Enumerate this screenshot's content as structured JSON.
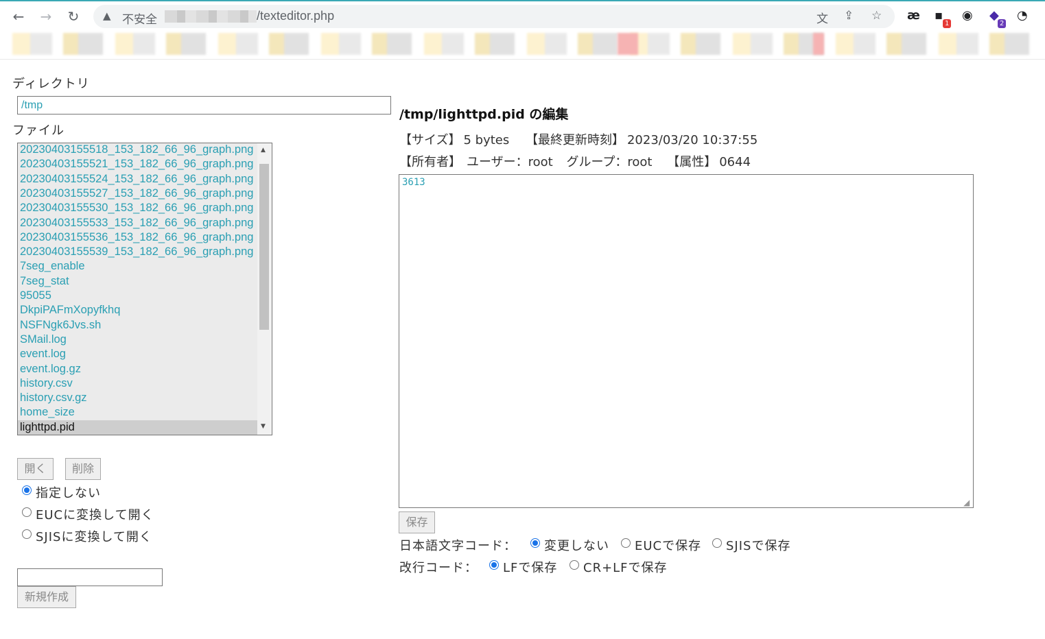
{
  "browser": {
    "insecure_label": "不安全",
    "url_path": "/texteditor.php",
    "extensions": [
      {
        "name": "ae-icon",
        "glyph": "æ"
      },
      {
        "name": "extension-badge-icon",
        "badge": "1",
        "badge_color": "#e53935"
      },
      {
        "name": "ring-icon",
        "glyph": "◉"
      },
      {
        "name": "stack-icon",
        "badge": "2",
        "badge_color": "#673ab7"
      }
    ]
  },
  "directory": {
    "label": "ディレクトリ",
    "value": "/tmp"
  },
  "file": {
    "label": "ファイル",
    "items": [
      "20230403155518_153_182_66_96_graph.png",
      "20230403155521_153_182_66_96_graph.png",
      "20230403155524_153_182_66_96_graph.png",
      "20230403155527_153_182_66_96_graph.png",
      "20230403155530_153_182_66_96_graph.png",
      "20230403155533_153_182_66_96_graph.png",
      "20230403155536_153_182_66_96_graph.png",
      "20230403155539_153_182_66_96_graph.png",
      "7seg_enable",
      "7seg_stat",
      "95055",
      "DkpiPAFmXopyfkhq",
      "NSFNgk6Jvs.sh",
      "SMail.log",
      "event.log",
      "event.log.gz",
      "history.csv",
      "history.csv.gz",
      "home_size",
      "lighttpd.pid"
    ],
    "selected": "lighttpd.pid"
  },
  "actions": {
    "open_label": "開く",
    "delete_label": "削除",
    "new_label": "新規作成",
    "new_value": ""
  },
  "open_options": [
    {
      "label": "指定しない",
      "checked": true
    },
    {
      "label": "EUCに変換して開く",
      "checked": false
    },
    {
      "label": "SJISに変換して開く",
      "checked": false
    }
  ],
  "editor": {
    "title": "/tmp/lighttpd.pid の編集",
    "size_label": "【サイズ】",
    "size_value": "5 bytes",
    "mtime_label": "【最終更新時刻】",
    "mtime_value": "2023/03/20 10:37:55",
    "owner_label": "【所有者】",
    "user_text": "ユーザー：root",
    "group_text": "グループ：root",
    "perm_label": "【属性】",
    "perm_value": "0644",
    "content": "3613",
    "save_label": "保存"
  },
  "encoding": {
    "label": "日本語文字コード：",
    "options": [
      {
        "label": "変更しない",
        "checked": true
      },
      {
        "label": "EUCで保存",
        "checked": false
      },
      {
        "label": "SJISで保存",
        "checked": false
      }
    ]
  },
  "newline": {
    "label": "改行コード：",
    "options": [
      {
        "label": "LFで保存",
        "checked": true
      },
      {
        "label": "CR+LFで保存",
        "checked": false
      }
    ]
  }
}
